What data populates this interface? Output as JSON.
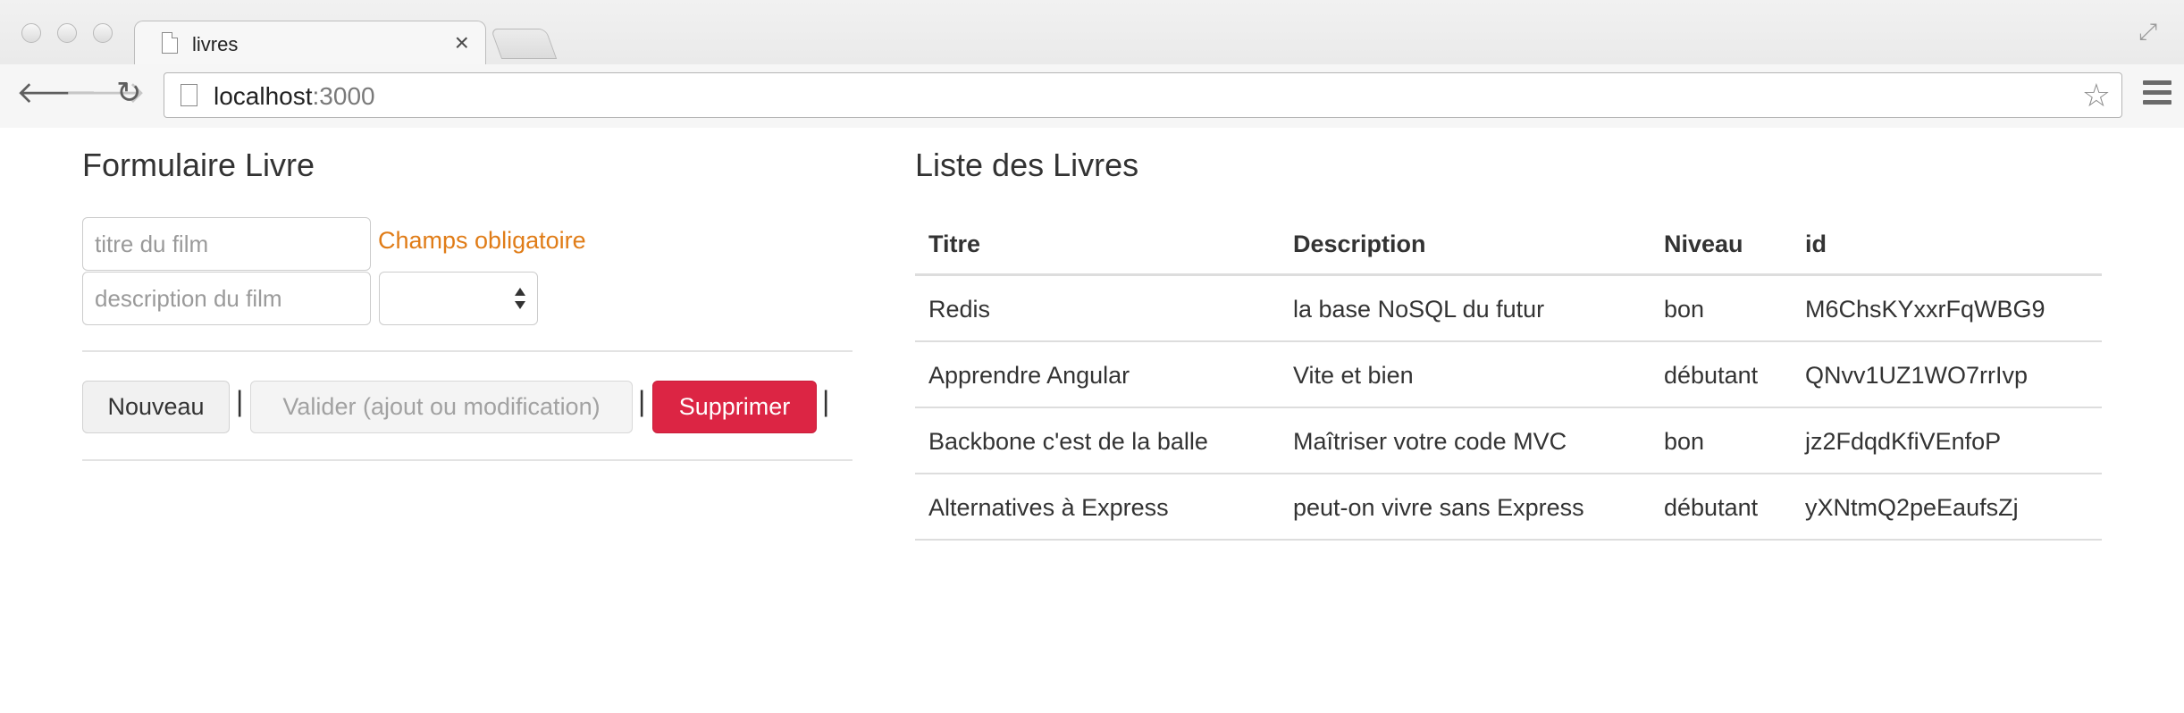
{
  "browser": {
    "tab_title": "livres",
    "close_glyph": "×",
    "url_host": "localhost",
    "url_port": ":3000",
    "back_glyph": "🡐",
    "forward_glyph": "🡒",
    "reload_glyph": "↻",
    "star_glyph": "☆",
    "fullscreen_glyph": "⤢"
  },
  "form": {
    "title": "Formulaire Livre",
    "title_placeholder": "titre du film",
    "description_placeholder": "description du film",
    "required_message": "Champs obligatoire",
    "level_select_value": "",
    "new_label": "Nouveau",
    "validate_label": "Valider (ajout ou modification)",
    "delete_label": "Supprimer",
    "separator": "|"
  },
  "list": {
    "title": "Liste des Livres",
    "headers": [
      "Titre",
      "Description",
      "Niveau",
      "id"
    ],
    "rows": [
      [
        "Redis",
        "la base NoSQL du futur",
        "bon",
        "M6ChsKYxxrFqWBG9"
      ],
      [
        "Apprendre Angular",
        "Vite et bien",
        "débutant",
        "QNvv1UZ1WO7rrIvp"
      ],
      [
        "Backbone c'est de la balle",
        "Maîtriser votre code MVC",
        "bon",
        "jz2FdqdKfiVEnfoP"
      ],
      [
        "Alternatives à Express",
        "peut-on vivre sans Express",
        "débutant",
        "yXNtmQ2peEaufsZj"
      ]
    ]
  },
  "colors": {
    "danger": "#dc2544",
    "warning_text": "#e07c17"
  }
}
